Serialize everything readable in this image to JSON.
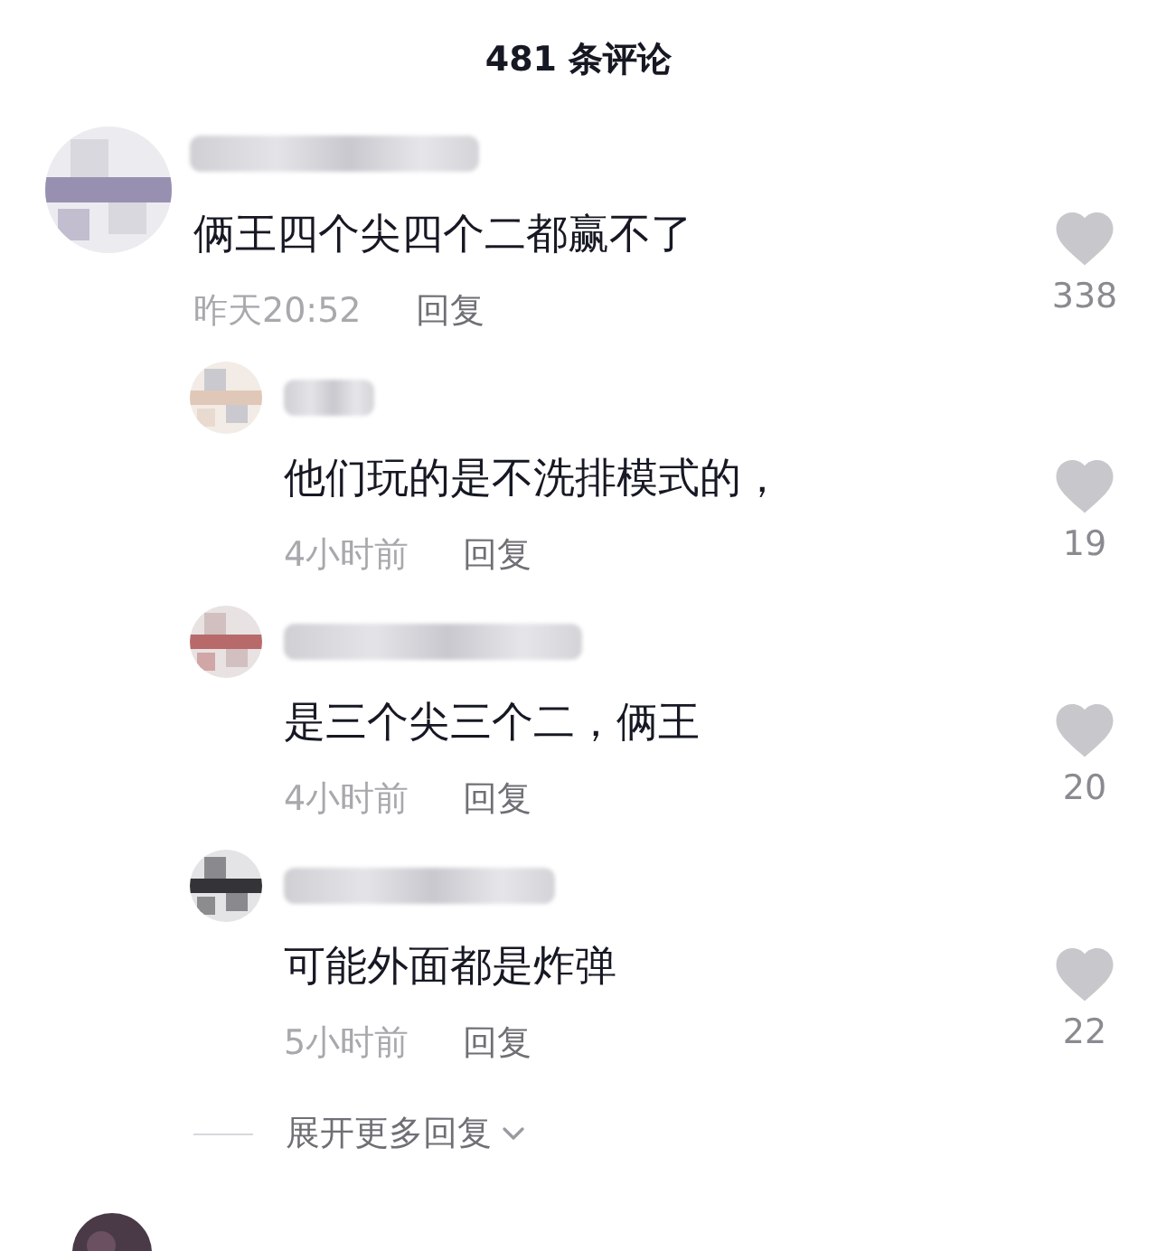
{
  "title": "481 条评论",
  "comment": {
    "text": "俩王四个尖四个二都赢不了",
    "time": "昨天20:52",
    "reply_label": "回复",
    "likes": "338"
  },
  "replies": [
    {
      "text": "他们玩的是不洗排模式的，",
      "time": "4小时前",
      "reply_label": "回复",
      "likes": "19"
    },
    {
      "text": "是三个尖三个二，俩王",
      "time": "4小时前",
      "reply_label": "回复",
      "likes": "20"
    },
    {
      "text": "可能外面都是炸弹",
      "time": "5小时前",
      "reply_label": "回复",
      "likes": "22"
    }
  ],
  "expand_label": "展开更多回复"
}
